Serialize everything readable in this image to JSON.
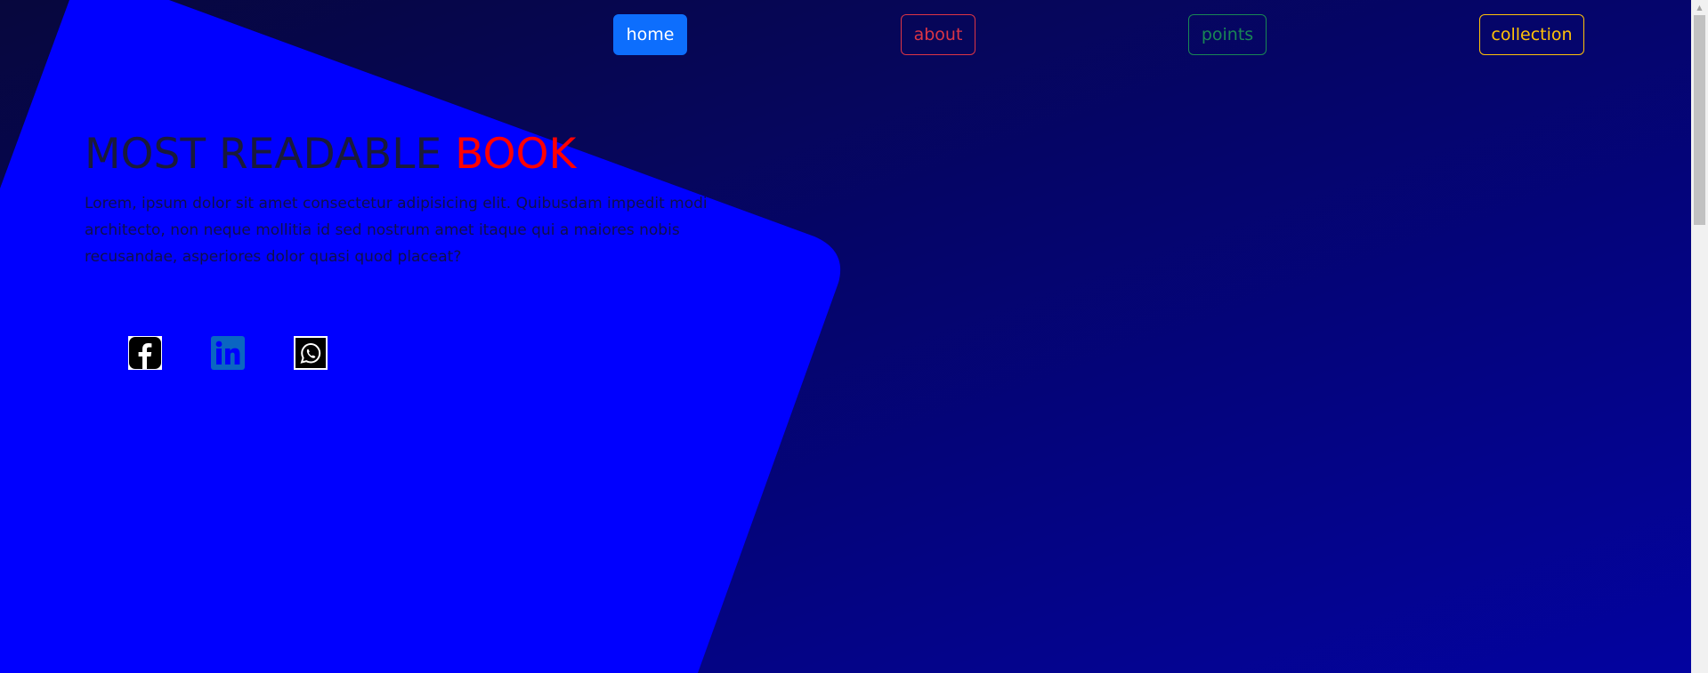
{
  "nav": {
    "home": "home",
    "about": "about",
    "points": "points",
    "collection": "collection"
  },
  "hero": {
    "title_main": "MOST READABLE ",
    "title_accent": "BOOK",
    "description": "Lorem, ipsum dolor sit amet consectetur adipisicing elit. Quibusdam impedit modi architecto, non neque mollitia id sed nostrum amet itaque qui a maiores nobis recusandae, asperiores dolor quasi quod placeat?"
  },
  "social": {
    "icons": [
      "facebook-icon",
      "linkedin-icon",
      "whatsapp-icon"
    ]
  },
  "colors": {
    "primary": "#0d6efd",
    "danger": "#dc3545",
    "success": "#198754",
    "warning": "#ffc107",
    "accent": "#ff0000",
    "shape": "#0000ff"
  }
}
